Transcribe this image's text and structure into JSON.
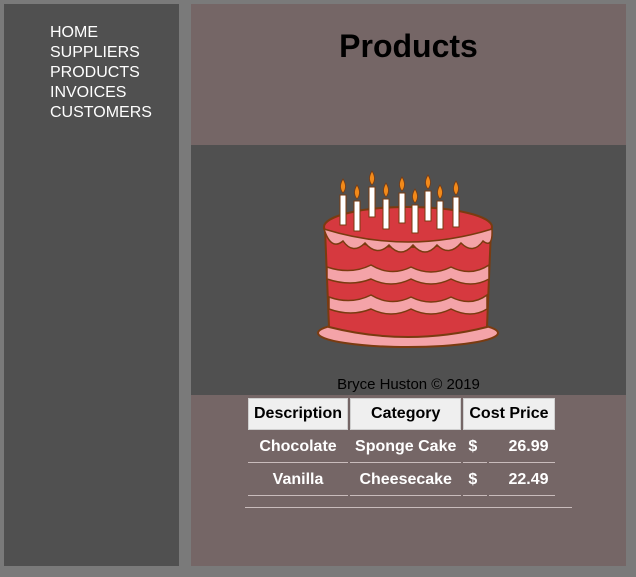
{
  "nav": {
    "items": [
      {
        "label": "HOME"
      },
      {
        "label": "SUPPLIERS"
      },
      {
        "label": "PRODUCTS"
      },
      {
        "label": "INVOICES"
      },
      {
        "label": "CUSTOMERS"
      }
    ]
  },
  "page": {
    "title": "Products",
    "footer": "Bryce Huston © 2019"
  },
  "banner": {
    "image": "birthday-cake-icon"
  },
  "table": {
    "headers": [
      "Description",
      "Category",
      "Cost Price"
    ],
    "rows": [
      {
        "description": "Chocolate",
        "category": "Sponge Cake",
        "currency": "$",
        "price": "26.99"
      },
      {
        "description": "Vanilla",
        "category": "Cheesecake",
        "currency": "$",
        "price": "22.49"
      }
    ]
  },
  "colors": {
    "sidebar": "#505050",
    "main": "#756666",
    "banner": "#505050",
    "cake_red": "#d6393f",
    "cake_pink": "#f4a3a8"
  }
}
